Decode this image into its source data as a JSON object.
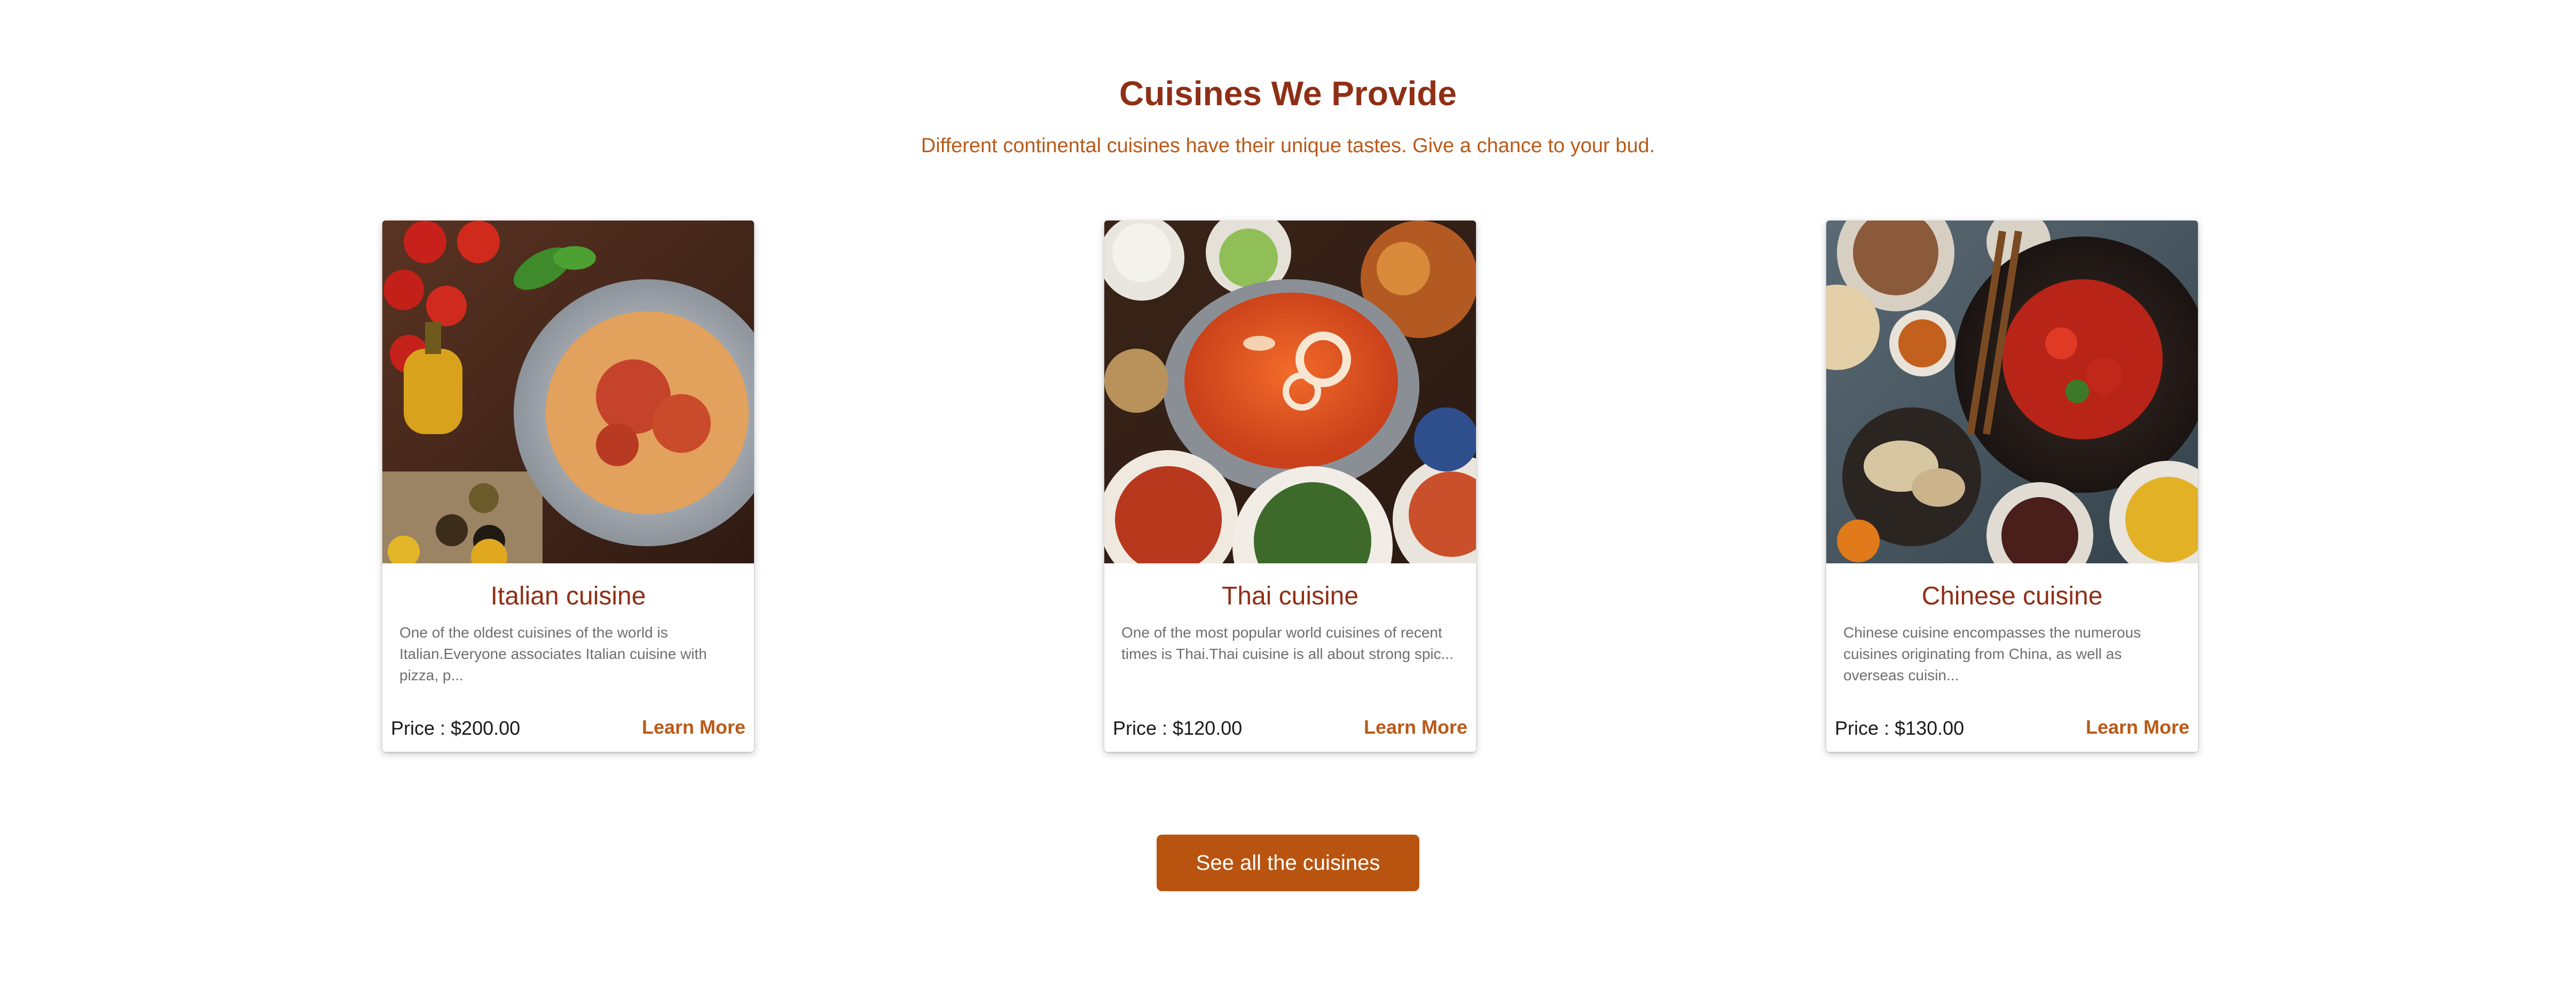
{
  "section": {
    "title": "Cuisines We Provide",
    "subtitle": "Different continental cuisines have their unique tastes. Give a chance to your bud."
  },
  "cards": [
    {
      "title": "Italian cuisine",
      "description": "One of the oldest cuisines of the world is Italian.Everyone associates Italian cuisine with pizza, p...",
      "price": "Price : $200.00",
      "link": "Learn More",
      "image_icon": "spaghetti-dish-image"
    },
    {
      "title": "Thai cuisine",
      "description": "One of the most popular world cuisines of recent times is Thai.Thai cuisine is all about strong spic...",
      "price": "Price : $120.00",
      "link": "Learn More",
      "image_icon": "thai-soup-image"
    },
    {
      "title": "Chinese cuisine",
      "description": "Chinese cuisine encompasses the numerous cuisines originating from China, as well as overseas cuisin...",
      "price": "Price : $130.00",
      "link": "Learn More",
      "image_icon": "chinese-wok-image"
    }
  ],
  "cta": {
    "label": "See all the cuisines"
  },
  "colors": {
    "heading": "#8f2f16",
    "subtitle": "#b95a19",
    "button": "#b85410",
    "link": "#b95a19"
  }
}
